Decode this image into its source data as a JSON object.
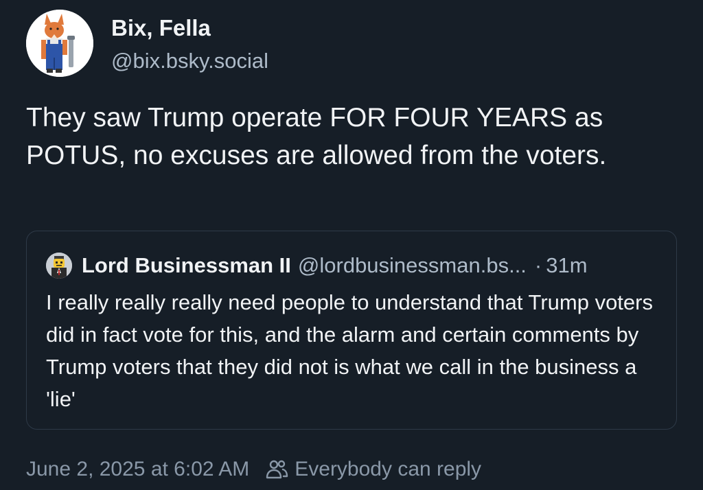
{
  "author": {
    "display_name": "Bix, Fella",
    "handle": "@bix.bsky.social",
    "avatar_icon": "fox-in-overalls-avatar"
  },
  "post": {
    "text": "They saw Trump operate FOR FOUR YEARS as POTUS, no excuses are allowed from the voters."
  },
  "quote": {
    "avatar_icon": "lego-figure-avatar",
    "display_name": "Lord Businessman II",
    "handle": "@lordbusinessman.bs...",
    "separator": "·",
    "time": "31m",
    "text": "I really really really need people to understand that Trump voters did in fact vote for this, and the alarm and certain comments by Trump voters that they did not is what we call in the business a 'lie'"
  },
  "footer": {
    "timestamp": "June 2, 2025 at 6:02 AM",
    "reply_icon": "people-icon",
    "reply_setting": "Everybody can reply"
  },
  "colors": {
    "background": "#161e27",
    "text_primary": "#f1f3f5",
    "text_secondary": "#aebbc9",
    "text_muted": "#8a98a8",
    "border": "#2e3a48"
  }
}
